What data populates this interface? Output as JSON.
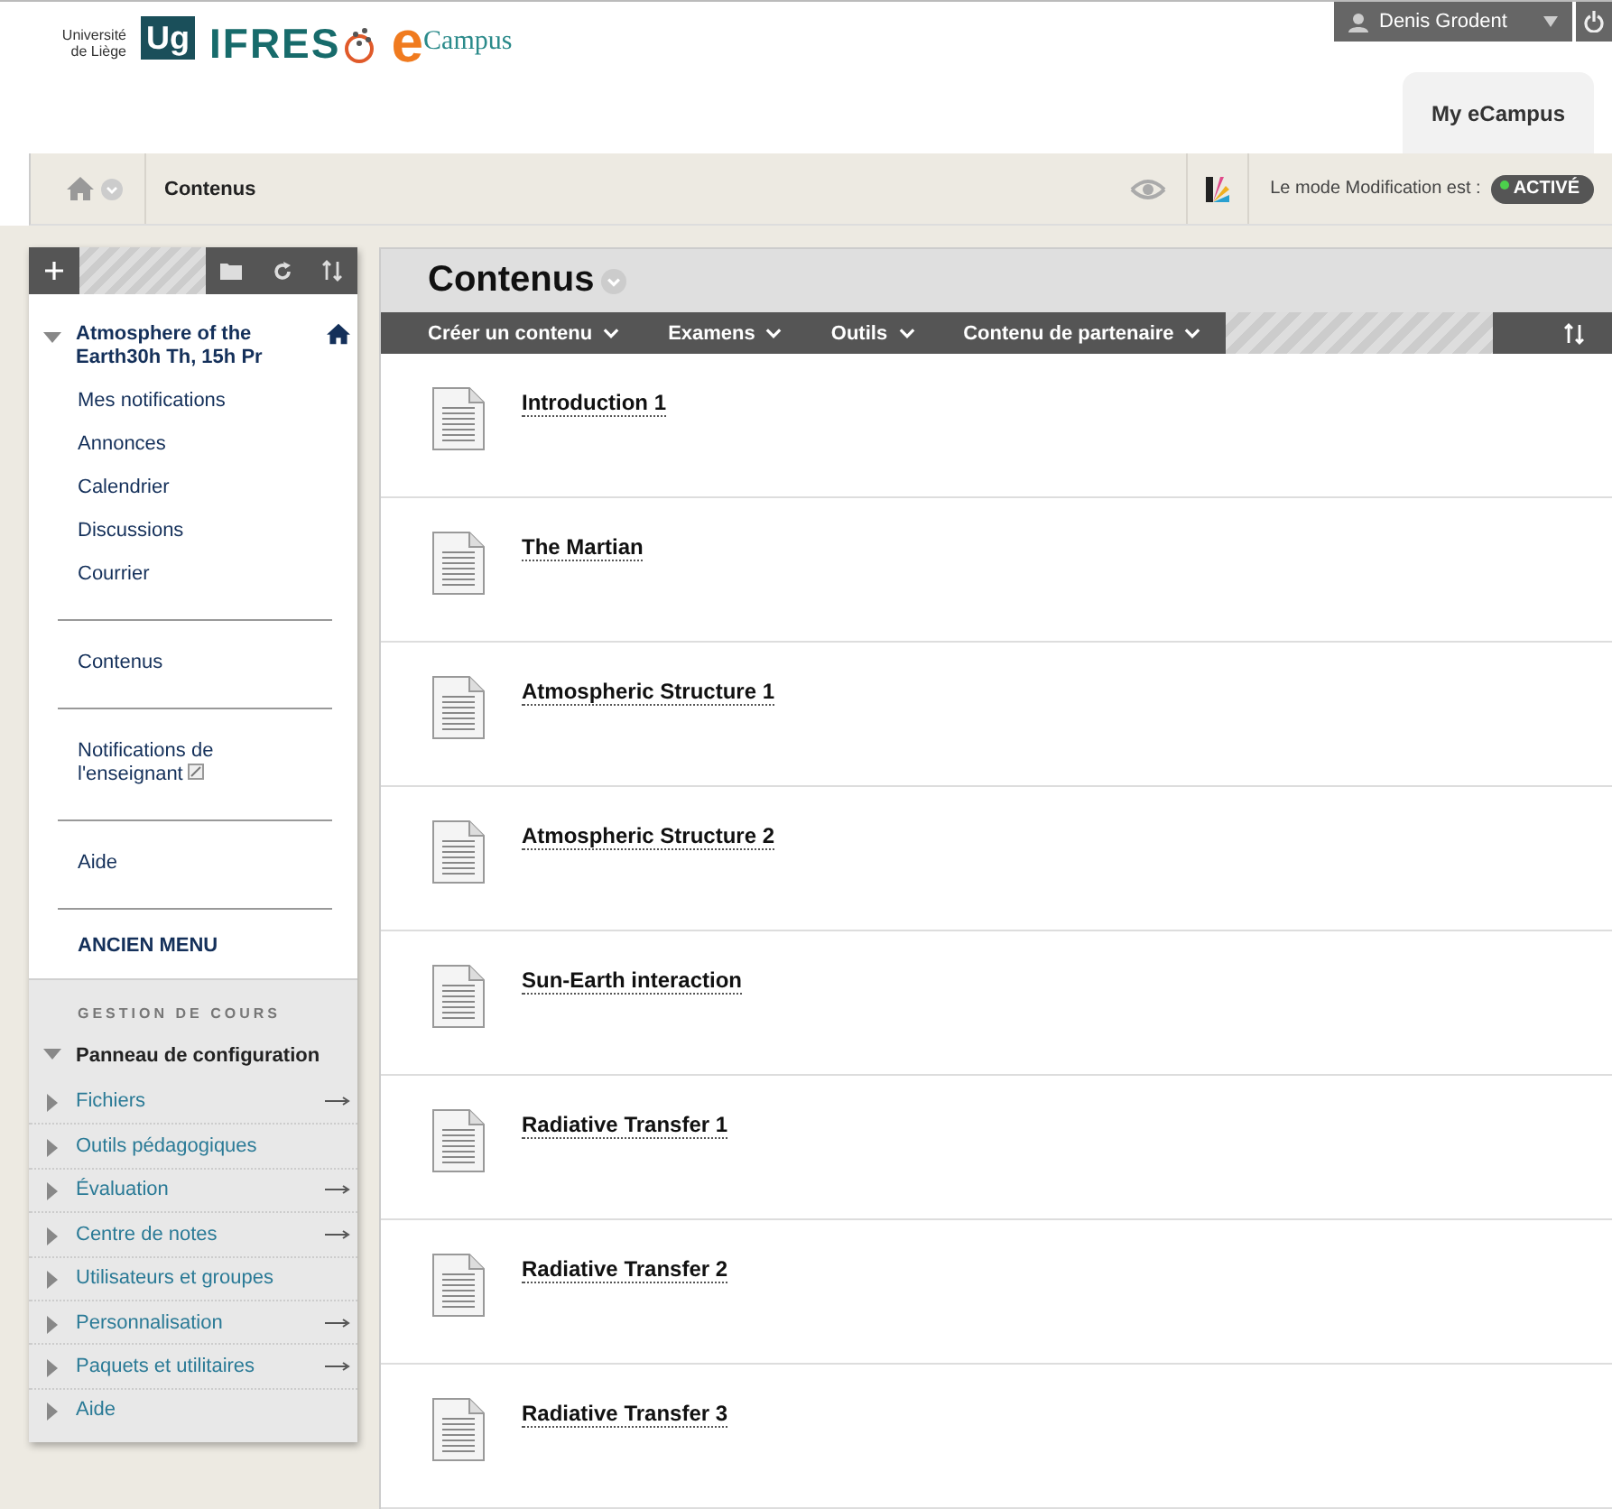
{
  "header": {
    "logo_university": "Université de Liège",
    "logo_mark": "Ug",
    "logo_ifres": "IFRES",
    "logo_ecampus_e": "e",
    "logo_ecampus": "Campus",
    "user": "Denis Grodent",
    "tab": "My eCampus"
  },
  "breadcrumb": {
    "current": "Contenus",
    "edit_mode_label": "Le mode Modification est :",
    "edit_mode_value": "ACTIVÉ",
    "edit_mode_on": true
  },
  "sidebar": {
    "course_title": "Atmosphere of the Earth30h Th, 15h Pr",
    "expanded": true,
    "groups": [
      [
        {
          "label": "Mes notifications",
          "external": false
        },
        {
          "label": "Annonces",
          "external": false
        },
        {
          "label": "Calendrier",
          "external": false
        },
        {
          "label": "Discussions",
          "external": false
        },
        {
          "label": "Courrier",
          "external": false
        }
      ],
      [
        {
          "label": "Contenus",
          "external": false
        }
      ],
      [
        {
          "label": "Notifications de l'enseignant",
          "external": true
        }
      ],
      [
        {
          "label": "Aide",
          "external": false
        }
      ]
    ],
    "old_menu": "ANCIEN MENU",
    "management": {
      "title": "GESTION DE COURS",
      "panel": "Panneau de configuration",
      "expanded": true,
      "items": [
        {
          "label": "Fichiers",
          "has_arrow": true
        },
        {
          "label": "Outils pédagogiques",
          "has_arrow": false
        },
        {
          "label": "Évaluation",
          "has_arrow": true
        },
        {
          "label": "Centre de notes",
          "has_arrow": true
        },
        {
          "label": "Utilisateurs et groupes",
          "has_arrow": false
        },
        {
          "label": "Personnalisation",
          "has_arrow": true
        },
        {
          "label": "Paquets et utilitaires",
          "has_arrow": true
        },
        {
          "label": "Aide",
          "has_arrow": false
        }
      ]
    }
  },
  "content": {
    "title": "Contenus",
    "menus": [
      "Créer un contenu",
      "Examens",
      "Outils",
      "Contenu de partenaire"
    ],
    "items": [
      "Introduction 1",
      "The Martian",
      "Atmospheric Structure 1",
      "Atmospheric Structure 2",
      "Sun-Earth interaction",
      "Radiative Transfer 1",
      "Radiative Transfer 2",
      "Radiative Transfer 3"
    ]
  }
}
